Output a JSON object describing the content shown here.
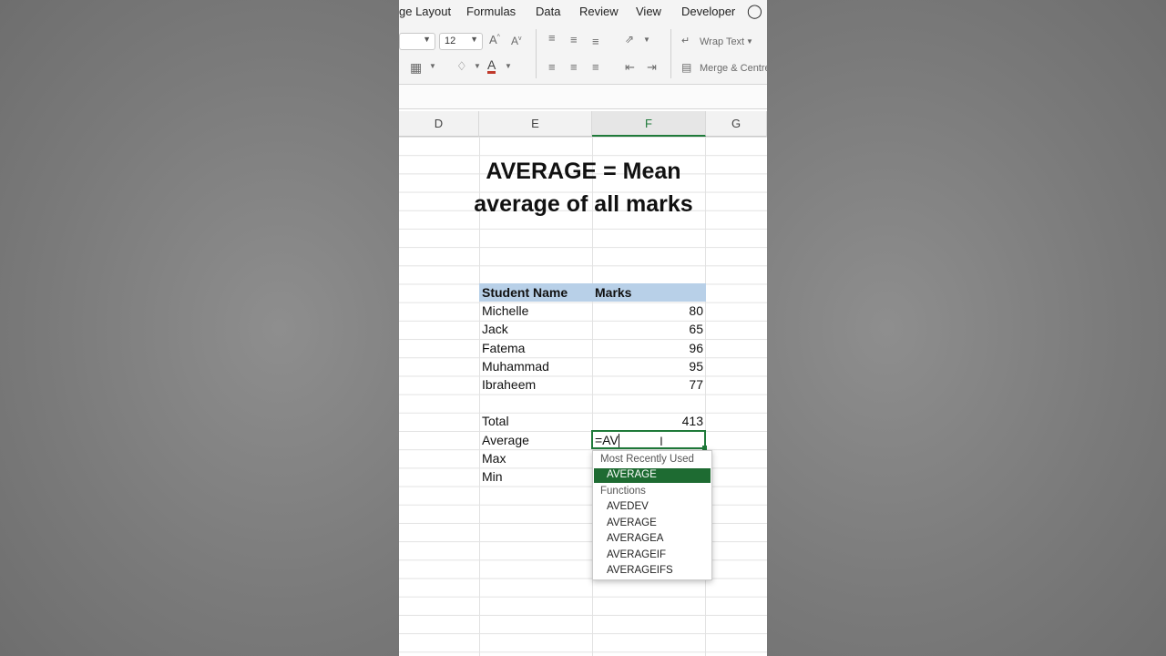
{
  "ribbon": {
    "tabs": [
      "ge Layout",
      "Formulas",
      "Data",
      "Review",
      "View",
      "Developer"
    ],
    "font_size": "12",
    "wrap_text": "Wrap Text",
    "merge_centre": "Merge & Centre"
  },
  "columns": [
    "D",
    "E",
    "F",
    "G"
  ],
  "selected_column": "F",
  "sheet": {
    "title_line1": "AVERAGE = Mean",
    "title_line2": "average of all marks",
    "header_name": "Student Name",
    "header_marks": "Marks",
    "students": [
      {
        "name": "Michelle",
        "marks": "80"
      },
      {
        "name": "Jack",
        "marks": "65"
      },
      {
        "name": "Fatema",
        "marks": "96"
      },
      {
        "name": "Muhammad",
        "marks": "95"
      },
      {
        "name": "Ibraheem",
        "marks": "77"
      }
    ],
    "total_label": "Total",
    "total_value": "413",
    "average_label": "Average",
    "max_label": "Max",
    "min_label": "Min",
    "active_cell_input": "=AV"
  },
  "autocomplete": {
    "group_recent": "Most Recently Used",
    "recent_items": [
      "AVERAGE"
    ],
    "group_functions": "Functions",
    "function_items": [
      "AVEDEV",
      "AVERAGE",
      "AVERAGEA",
      "AVERAGEIF",
      "AVERAGEIFS"
    ]
  },
  "colors": {
    "accent_green": "#1f7a3a",
    "header_fill": "#b8d0e8",
    "highlight": "#1e6b32"
  }
}
